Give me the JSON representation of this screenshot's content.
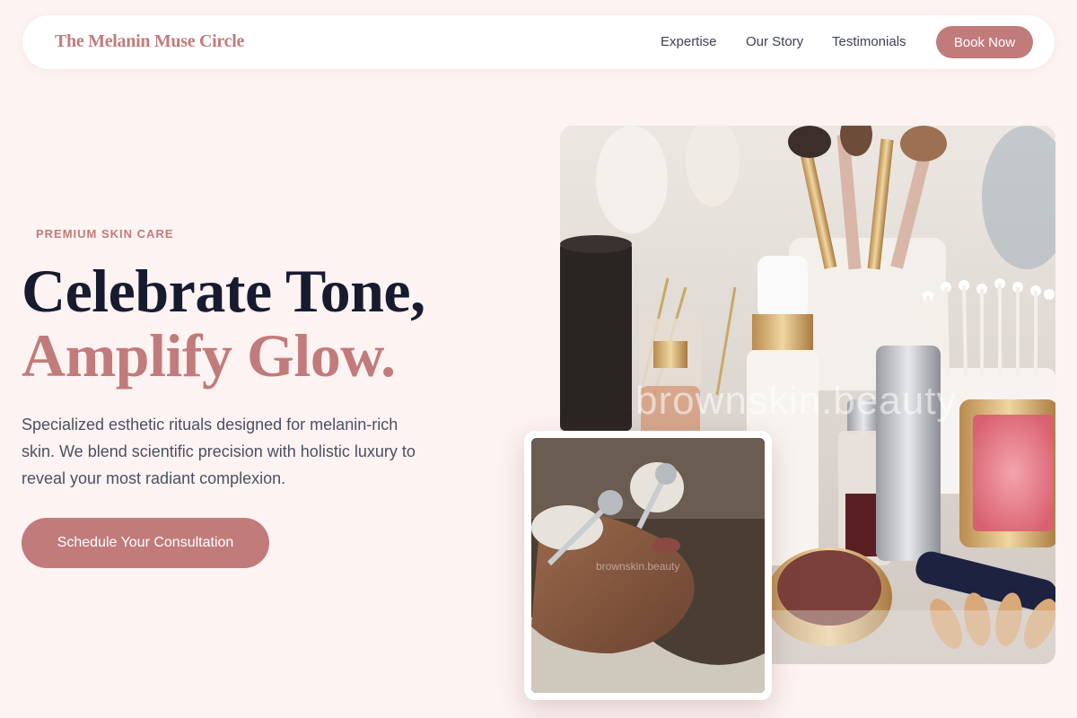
{
  "nav": {
    "logo": "The Melanin Muse Circle",
    "links": [
      "Expertise",
      "Our Story",
      "Testimonials"
    ],
    "cta": "Book Now"
  },
  "hero": {
    "eyebrow": "PREMIUM SKIN CARE",
    "headline_line1": "Celebrate Tone,",
    "headline_line2": "Amplify Glow.",
    "description": "Specialized esthetic rituals designed for melanin-rich skin. We blend scientific precision with holistic luxury to reveal your most radiant complexion.",
    "cta": "Schedule Your Consultation"
  },
  "images": {
    "main_watermark": "brownskin.beauty",
    "inset_watermark": "brownskin.beauty"
  },
  "colors": {
    "background": "#fdf3f2",
    "accent": "#c17b7b",
    "heading": "#161b30",
    "body_text": "#4b5060"
  }
}
